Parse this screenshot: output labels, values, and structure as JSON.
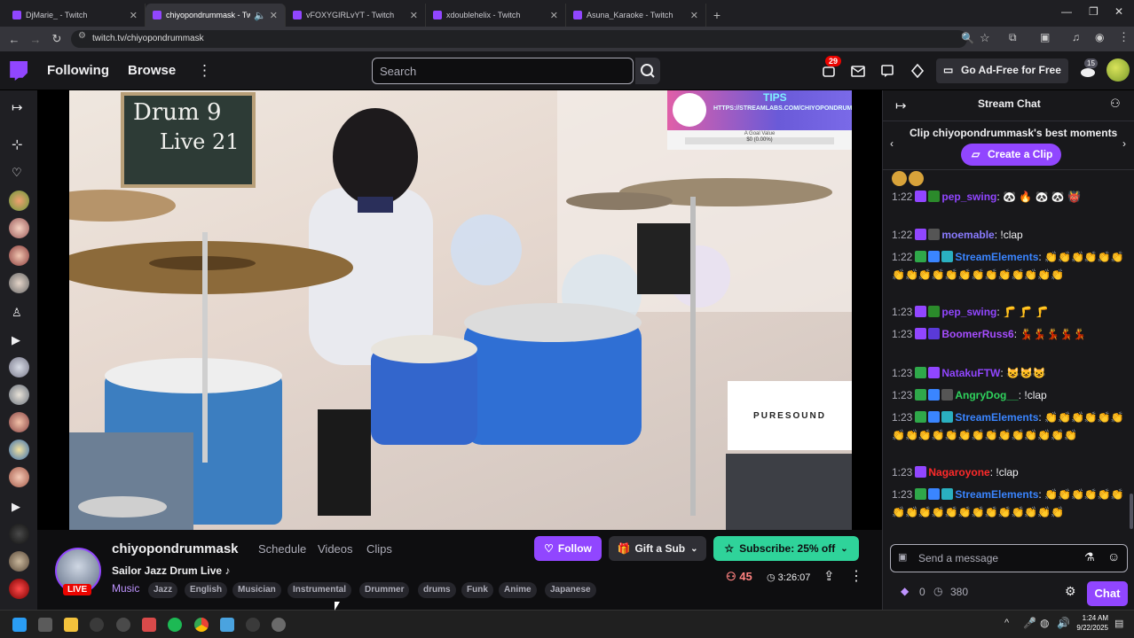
{
  "browser": {
    "tabs": [
      {
        "title": "DjMarie_ - Twitch",
        "active": false
      },
      {
        "title": "chiyopondrummask - Twit",
        "active": true
      },
      {
        "title": "vFOXYGIRLvYT - Twitch",
        "active": false
      },
      {
        "title": "xdoublehelix - Twitch",
        "active": false
      },
      {
        "title": "Asuna_Karaoke - Twitch",
        "active": false
      }
    ],
    "url": "twitch.tv/chiyopondrummask"
  },
  "topnav": {
    "following": "Following",
    "browse": "Browse",
    "search_placeholder": "Search",
    "notifications_count": "29",
    "whispers_count": "15",
    "ad_free": "Go Ad-Free for Free"
  },
  "video": {
    "chalkboard_line1": "Drum 9",
    "chalkboard_line2": "Live 21",
    "tips_title": "TIPS",
    "tips_url": "HTTPS://STREAMLABS.COM/CHIYOPONDRUMMASK/TIP",
    "tips_goal": "A Goal Value",
    "tips_progress": "$0 (0.00%)",
    "sponsor": "PURESOUND"
  },
  "stream": {
    "channel": "chiyopondrummask",
    "tabs": [
      "Schedule",
      "Videos",
      "Clips"
    ],
    "title": "Sailor Jazz Drum Live ♪",
    "category": "Music",
    "live": "LIVE",
    "tags": [
      "Jazz",
      "English",
      "Musician",
      "Instrumental",
      "Drummer",
      "drums",
      "Funk",
      "Anime",
      "Japanese"
    ],
    "follow_label": "Follow",
    "gift_label": "Gift a Sub",
    "subscribe_label": "Subscribe: 25% off",
    "viewers": "45",
    "uptime": "3:26:07"
  },
  "chat": {
    "header": "Stream Chat",
    "clip_prompt": "Clip chiyopondrummask's best moments",
    "create_clip": "Create a Clip",
    "messages": [
      {
        "time": "1:22",
        "user": "pep_swing",
        "color": "#9146ff",
        "text": ": 🐼 🔥 🐼 🐼 👹"
      },
      {
        "time": "1:22",
        "user": "moemable",
        "color": "#8a7bff",
        "text": ": !clap"
      },
      {
        "time": "1:22",
        "user": "StreamElements",
        "color": "#3a85ff",
        "text": ": 👏👏👏👏👏👏👏👏👏👏👏👏👏👏👏👏👏👏👏"
      },
      {
        "time": "1:23",
        "user": "pep_swing",
        "color": "#9146ff",
        "text": ": 🦵 🦵 🦵"
      },
      {
        "time": "1:23",
        "user": "BoomerRuss6",
        "color": "#a64dff",
        "text": ": 💃💃💃💃💃"
      },
      {
        "time": "1:23",
        "user": "NatakuFTW",
        "color": "#9146ff",
        "text": ": 😺😺😺"
      },
      {
        "time": "1:23",
        "user": "AngryDog__",
        "color": "#2fd35d",
        "text": ": !clap"
      },
      {
        "time": "1:23",
        "user": "StreamElements",
        "color": "#3a85ff",
        "text": ": 👏👏👏👏👏👏👏👏👏👏👏👏👏👏👏👏👏👏👏👏"
      },
      {
        "time": "1:23",
        "user": "Nagaroyone",
        "color": "#ff2a2a",
        "text": ": !clap"
      },
      {
        "time": "1:23",
        "user": "StreamElements",
        "color": "#3a85ff",
        "text": ": 👏👏👏👏👏👏👏👏👏👏👏👏👏👏👏👏👏👏👏"
      }
    ],
    "input_placeholder": "Send a message",
    "bits": "0",
    "points": "380",
    "chat_button": "Chat"
  },
  "taskbar": {
    "time": "1:24 AM",
    "date": "9/22/2025"
  }
}
